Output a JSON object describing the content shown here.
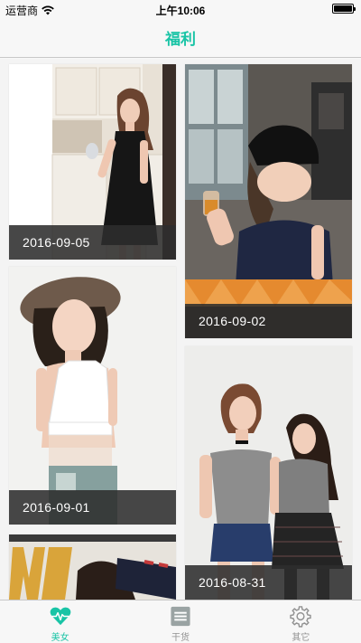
{
  "status": {
    "carrier": "运营商",
    "time": "上午10:06"
  },
  "nav": {
    "title": "福利"
  },
  "feed": {
    "items": [
      {
        "date": "2016-09-05"
      },
      {
        "date": "2016-09-02"
      },
      {
        "date": "2016-09-01"
      },
      {
        "date": "2016-08-31"
      }
    ]
  },
  "tabs": [
    {
      "label": "美女",
      "icon": "heart-pulse-icon",
      "active": true
    },
    {
      "label": "干货",
      "icon": "list-icon",
      "active": false
    },
    {
      "label": "其它",
      "icon": "gear-icon",
      "active": false
    }
  ],
  "colors": {
    "accent": "#19c4a6",
    "inactive": "#929292"
  }
}
